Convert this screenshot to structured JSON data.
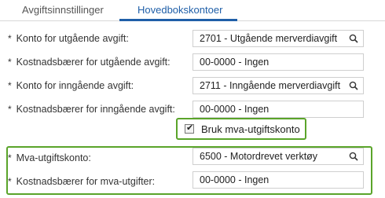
{
  "tabs": [
    {
      "label": "Avgiftsinnstillinger",
      "active": false
    },
    {
      "label": "Hovedbokskontoer",
      "active": true
    }
  ],
  "form": {
    "rows": [
      {
        "label": "Konto for utgående avgift:",
        "value": "2701 - Utgående merverdiavgift",
        "has_search": true
      },
      {
        "label": "Kostnadsbærer for utgående avgift:",
        "value": "00-0000 - Ingen",
        "has_search": false
      },
      {
        "label": "Konto for inngående avgift:",
        "value": "2711 - Inngående merverdiavgift",
        "has_search": true
      },
      {
        "label": "Kostnadsbærer for inngående avgift:",
        "value": "00-0000 - Ingen",
        "has_search": false
      }
    ],
    "checkbox": {
      "label": "Bruk mva-utgiftskonto",
      "checked": true
    },
    "expense_rows": [
      {
        "label": "Mva-utgiftskonto:",
        "value": "6500 - Motordrevet verktøy",
        "has_search": true
      },
      {
        "label": "Kostnadsbærer for mva-utgifter:",
        "value": "00-0000 - Ingen",
        "has_search": false
      }
    ]
  },
  "required_marker": "*",
  "colors": {
    "accent": "#1f5fa8",
    "highlight": "#5aa42a"
  }
}
